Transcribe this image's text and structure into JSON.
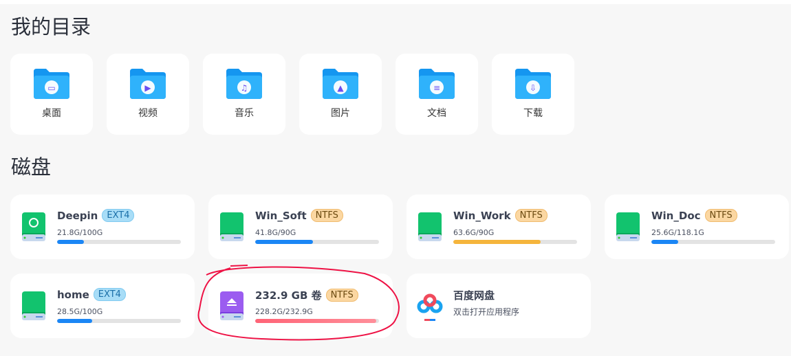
{
  "sections": {
    "dirs_title": "我的目录",
    "disks_title": "磁盘"
  },
  "folders": [
    {
      "label": "桌面",
      "icon": "desktop-folder-icon"
    },
    {
      "label": "视频",
      "icon": "video-folder-icon"
    },
    {
      "label": "音乐",
      "icon": "music-folder-icon"
    },
    {
      "label": "图片",
      "icon": "pictures-folder-icon"
    },
    {
      "label": "文档",
      "icon": "documents-folder-icon"
    },
    {
      "label": "下载",
      "icon": "downloads-folder-icon"
    }
  ],
  "disks": [
    {
      "name": "Deepin",
      "fs": "EXT4",
      "size": "21.8G/100G",
      "usage": 21.8
    },
    {
      "name": "Win_Soft",
      "fs": "NTFS",
      "size": "41.8G/90G",
      "usage": 46.4
    },
    {
      "name": "Win_Work",
      "fs": "NTFS",
      "size": "63.6G/90G",
      "usage": 70.7
    },
    {
      "name": "Win_Doc",
      "fs": "NTFS",
      "size": "25.6G/118.1G",
      "usage": 21.7
    },
    {
      "name": "home",
      "fs": "EXT4",
      "size": "28.5G/100G",
      "usage": 28.5
    },
    {
      "name": "232.9 GB 卷",
      "fs": "NTFS",
      "size": "228.2G/232.9G",
      "usage": 98
    }
  ],
  "app": {
    "name": "百度网盘",
    "desc": "双击打开应用程序"
  },
  "colors": {
    "bar_blue": "#1b86f5",
    "bar_orange": "#f5b53c",
    "bar_red": "#ff6b7a",
    "annotation": "#ee1144"
  }
}
